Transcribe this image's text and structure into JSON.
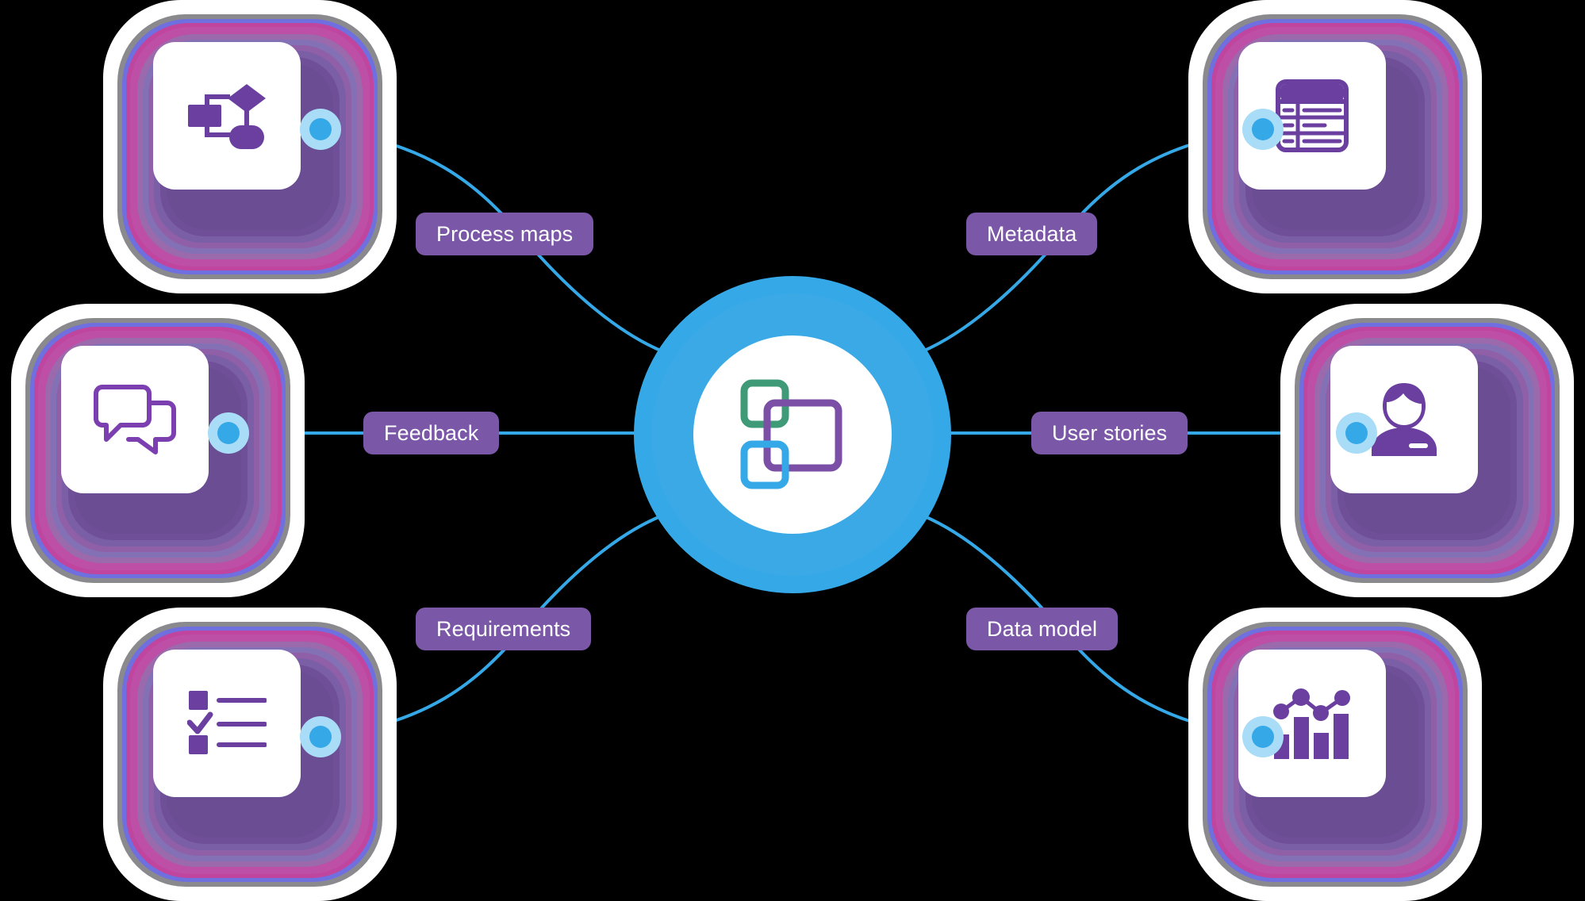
{
  "diagram": {
    "title": "Capability hub diagram",
    "center": {
      "name": "center-hub",
      "icon": "overlapping-squares-icon",
      "ring_color": "#35a8e8",
      "inner_color": "#ffffff",
      "icon_colors": {
        "small_top": "#3f9b77",
        "large": "#7b4fa5",
        "small_bottom": "#35a8e8"
      }
    },
    "pill_color": "#7b57a8",
    "pill_text_color": "#ffffff",
    "connector_color": "#35a8e8",
    "dot_color": "#35a8e8",
    "dot_halo_color": "#a8dcf7",
    "node_icon_color": "#6a3fa0",
    "nodes": [
      {
        "id": "process-maps",
        "label": "Process maps",
        "icon": "flowchart-icon",
        "position": "top-left",
        "connector": "curve"
      },
      {
        "id": "metadata",
        "label": "Metadata",
        "icon": "table-grid-icon",
        "position": "top-right",
        "connector": "curve"
      },
      {
        "id": "feedback",
        "label": "Feedback",
        "icon": "speech-bubbles-icon",
        "position": "middle-left",
        "connector": "straight"
      },
      {
        "id": "user-stories",
        "label": "User stories",
        "icon": "user-avatar-icon",
        "position": "middle-right",
        "connector": "straight"
      },
      {
        "id": "requirements",
        "label": "Requirements",
        "icon": "checklist-icon",
        "position": "bottom-left",
        "connector": "curve"
      },
      {
        "id": "data-model",
        "label": "Data model",
        "icon": "bar-chart-icon",
        "position": "bottom-right",
        "connector": "curve"
      }
    ]
  }
}
